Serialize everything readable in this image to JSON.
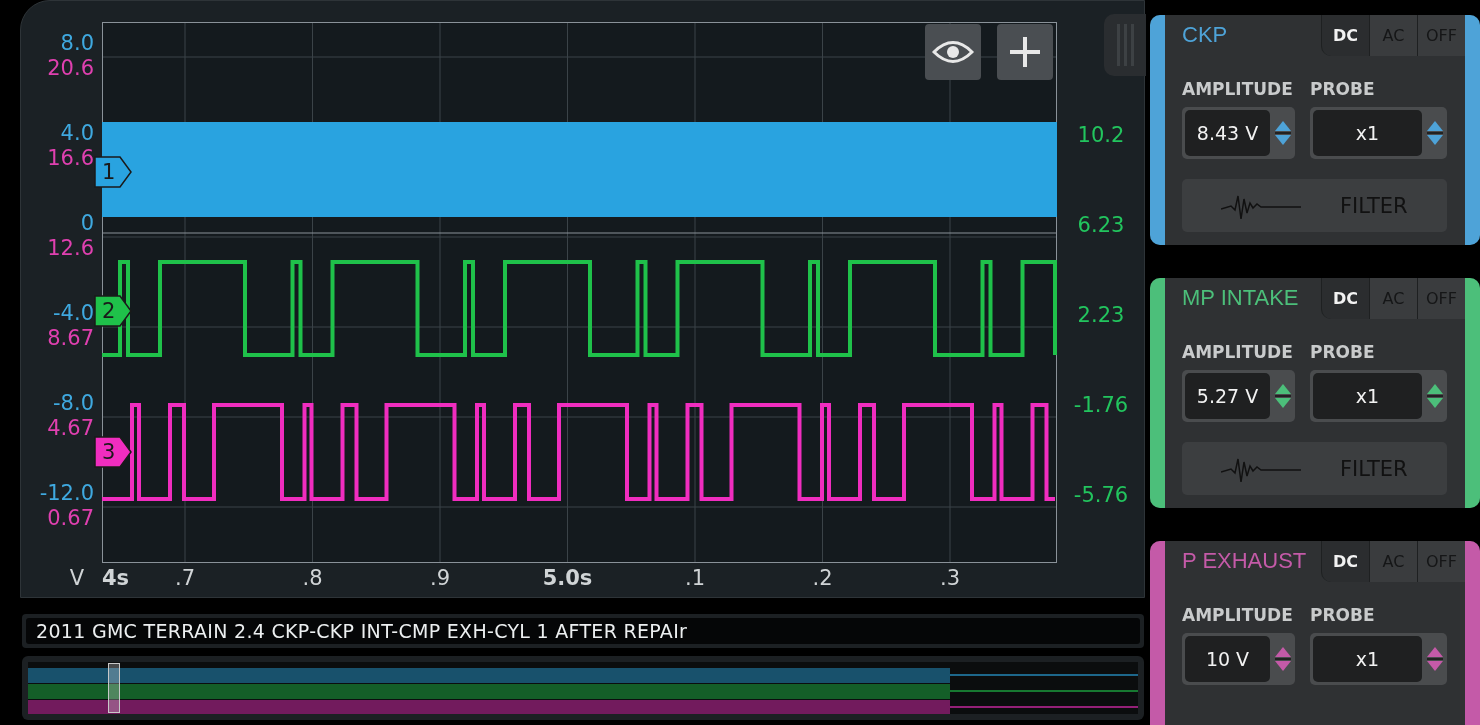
{
  "scope": {
    "left_axis": [
      {
        "upper": "8.0",
        "lower": "20.6"
      },
      {
        "upper": "4.0",
        "lower": "16.6"
      },
      {
        "upper": "0",
        "lower": "12.6"
      },
      {
        "upper": "-4.0",
        "lower": "8.67"
      },
      {
        "upper": "-8.0",
        "lower": "4.67"
      },
      {
        "upper": "-12.0",
        "lower": "0.67"
      }
    ],
    "right_axis": [
      "10.2",
      "6.23",
      "2.23",
      "-1.76",
      "-5.76"
    ],
    "unit": "V",
    "x_ticks": [
      {
        "label": "4s",
        "major": true
      },
      {
        "label": ".7",
        "major": false
      },
      {
        "label": ".8",
        "major": false
      },
      {
        "label": ".9",
        "major": false
      },
      {
        "label": "5.0s",
        "major": true
      },
      {
        "label": ".1",
        "major": false
      },
      {
        "label": ".2",
        "major": false
      },
      {
        "label": ".3",
        "major": false
      }
    ],
    "traces": [
      {
        "number": "1",
        "color": "#29a3e0",
        "kind": "band"
      },
      {
        "number": "2",
        "color": "#1fc14a",
        "kind": "square"
      },
      {
        "number": "3",
        "color": "#f02dbf",
        "kind": "square"
      }
    ]
  },
  "recording_title": "2011 GMC TERRAIN 2.4 CKP-CKP INT-CMP EXH-CYL 1 AFTER REPAIr",
  "channels": [
    {
      "name": "CKP",
      "color": "#4ea3d8",
      "coupling": [
        {
          "label": "DC",
          "selected": true
        },
        {
          "label": "AC",
          "selected": false
        },
        {
          "label": "OFF",
          "selected": false
        }
      ],
      "amplitude_label": "AMPLITUDE",
      "amplitude": "8.43 V",
      "probe_label": "PROBE",
      "probe": "x1",
      "filter": "FILTER"
    },
    {
      "name": "MP INTAKE",
      "color": "#4cbf7a",
      "coupling": [
        {
          "label": "DC",
          "selected": true
        },
        {
          "label": "AC",
          "selected": false
        },
        {
          "label": "OFF",
          "selected": false
        }
      ],
      "amplitude_label": "AMPLITUDE",
      "amplitude": "5.27 V",
      "probe_label": "PROBE",
      "probe": "x1",
      "filter": "FILTER"
    },
    {
      "name": "P EXHAUST",
      "color": "#c45aa8",
      "coupling": [
        {
          "label": "DC",
          "selected": true
        },
        {
          "label": "AC",
          "selected": false
        },
        {
          "label": "OFF",
          "selected": false
        }
      ],
      "amplitude_label": "AMPLITUDE",
      "amplitude": "10 V",
      "probe_label": "PROBE",
      "probe": "x1"
    }
  ]
}
